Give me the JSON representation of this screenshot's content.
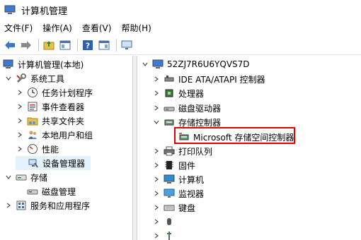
{
  "window": {
    "title": "计算机管理"
  },
  "menu": {
    "items": [
      "文件(F)",
      "操作(A)",
      "查看(V)",
      "帮助(H)"
    ]
  },
  "toolbar": {
    "icons": [
      "back-arrow-icon",
      "forward-arrow-icon",
      "up-folder-icon",
      "show-hide-tree-icon",
      "help-icon",
      "properties-icon",
      "monitor-icon"
    ]
  },
  "left_tree": {
    "root": "计算机管理(本地)",
    "system_tools": "系统工具",
    "task_scheduler": "任务计划程序",
    "event_viewer": "事件查看器",
    "shared_folders": "共享文件夹",
    "local_users": "本地用户和组",
    "performance": "性能",
    "device_manager": "设备管理器",
    "storage": "存储",
    "disk_management": "磁盘管理",
    "services_apps": "服务和应用程序"
  },
  "device_tree": {
    "computer_name": "52ZJ7R6U6YQVS7D",
    "ide": "IDE ATA/ATAPI 控制器",
    "processor": "处理器",
    "disk_drives": "磁盘驱动器",
    "storage_controllers": "存储控制器",
    "ms_storage_spaces": "Microsoft 存储空间控制器",
    "print_queues": "打印队列",
    "firmware": "固件",
    "computer": "计算机",
    "monitors": "监视器",
    "keyboard": "键盘"
  },
  "colors": {
    "highlight_border": "#e00000",
    "selected_bg": "#e5f1fb",
    "accent_blue": "#1e6fc6"
  }
}
